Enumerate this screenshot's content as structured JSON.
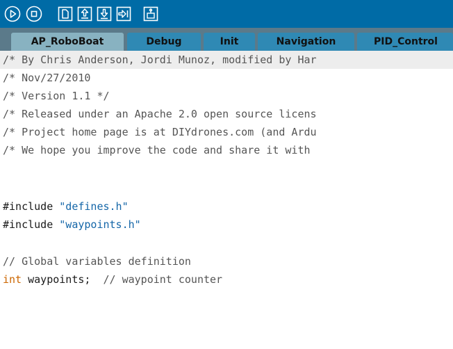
{
  "toolbar": {
    "buttons": [
      {
        "name": "run-button",
        "icon": "play-icon"
      },
      {
        "name": "stop-button",
        "icon": "stop-icon"
      },
      {
        "name": "new-button",
        "icon": "new-file-icon"
      },
      {
        "name": "open-button",
        "icon": "open-icon"
      },
      {
        "name": "save-button",
        "icon": "save-icon"
      },
      {
        "name": "upload-button",
        "icon": "upload-icon"
      },
      {
        "name": "serial-monitor-button",
        "icon": "serial-monitor-icon"
      }
    ],
    "colors": {
      "background": "#006ba6",
      "icon": "#ffffff"
    }
  },
  "tabs": [
    {
      "label": "AP_RoboBoat",
      "active": true
    },
    {
      "label": "Debug",
      "active": false
    },
    {
      "label": "Init",
      "active": false
    },
    {
      "label": "Navigation",
      "active": false
    },
    {
      "label": "PID_Control",
      "active": false
    }
  ],
  "editor": {
    "lines": {
      "l1": "/* By Chris Anderson, Jordi Munoz, modified by Har",
      "l2": "/* Nov/27/2010",
      "l3": "/* Version 1.1 */",
      "l4": "/* Released under an Apache 2.0 open source licens",
      "l5": "/* Project home page is at DIYdrones.com (and Ardu",
      "l6": "/* We hope you improve the code and share it with",
      "l7": "",
      "l8": "",
      "l9_pre": "#include ",
      "l9_str": "\"defines.h\"",
      "l10_pre": "#include ",
      "l10_str": "\"waypoints.h\"",
      "l11": "",
      "l12": "// Global variables definition",
      "l13_type": "int",
      "l13_code": " waypoints;  ",
      "l13_comment": "// waypoint counter"
    },
    "colors": {
      "comment": "#555555",
      "string": "#1466a8",
      "type": "#cc6600"
    }
  }
}
